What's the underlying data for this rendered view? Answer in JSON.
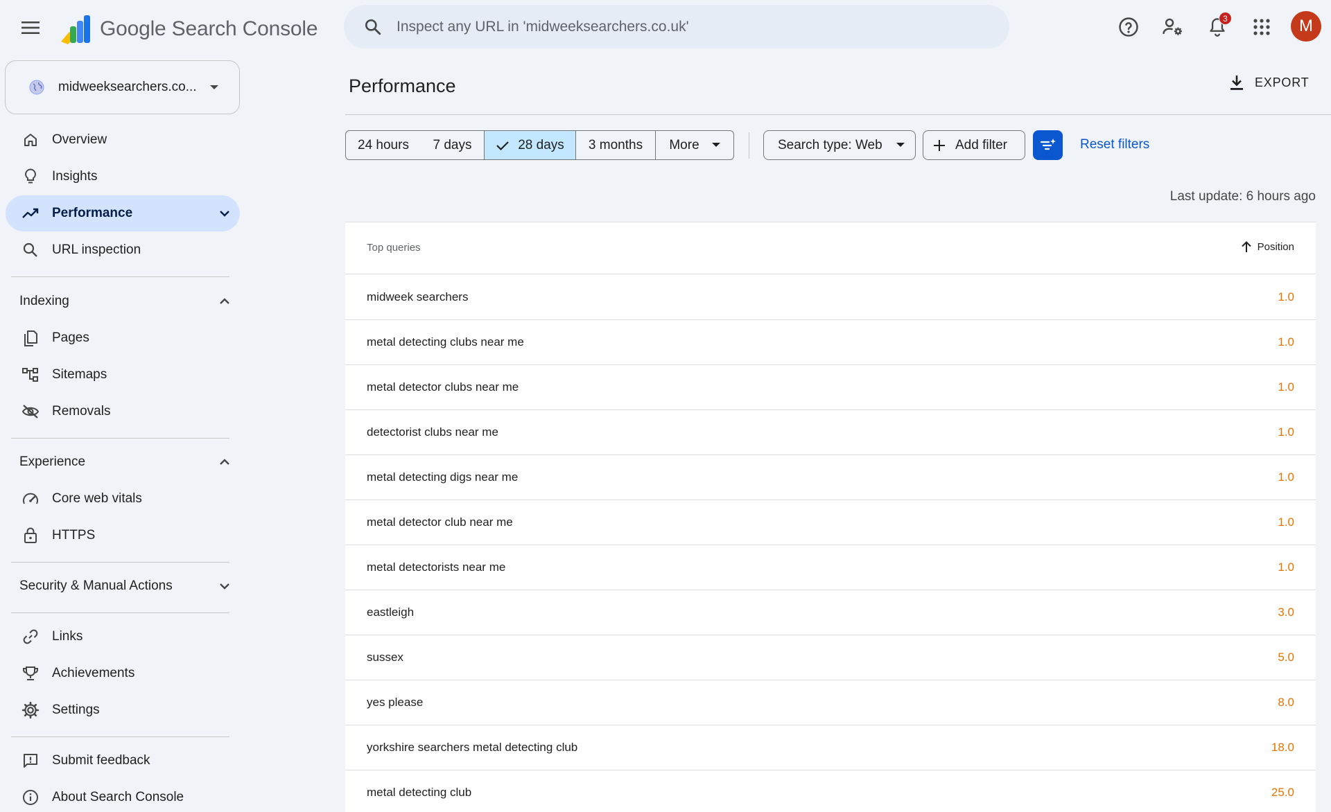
{
  "app": {
    "title": "Google Search Console",
    "search_placeholder": "Inspect any URL in 'midweeksearchers.co.uk'",
    "notification_count": "3",
    "avatar_letter": "M"
  },
  "sidebar": {
    "property": "midweeksearchers.co...",
    "items_top": [
      {
        "label": "Overview",
        "icon": "home-icon"
      },
      {
        "label": "Insights",
        "icon": "lightbulb-icon"
      },
      {
        "label": "Performance",
        "icon": "trending-up-icon"
      },
      {
        "label": "URL inspection",
        "icon": "search-icon"
      }
    ],
    "indexing": {
      "label": "Indexing",
      "items": [
        {
          "label": "Pages",
          "icon": "pages-icon"
        },
        {
          "label": "Sitemaps",
          "icon": "sitemap-icon"
        },
        {
          "label": "Removals",
          "icon": "visibility-off-icon"
        }
      ]
    },
    "experience": {
      "label": "Experience",
      "items": [
        {
          "label": "Core web vitals",
          "icon": "speed-gauge-icon"
        },
        {
          "label": "HTTPS",
          "icon": "lock-icon"
        }
      ]
    },
    "security": {
      "label": "Security & Manual Actions"
    },
    "items_bottom": [
      {
        "label": "Links",
        "icon": "link-icon"
      },
      {
        "label": "Achievements",
        "icon": "trophy-icon"
      },
      {
        "label": "Settings",
        "icon": "gear-icon"
      }
    ],
    "items_footer": [
      {
        "label": "Submit feedback",
        "icon": "feedback-icon"
      },
      {
        "label": "About Search Console",
        "icon": "info-icon"
      }
    ]
  },
  "main": {
    "title": "Performance",
    "export_label": "EXPORT",
    "date_ranges": [
      "24 hours",
      "7 days",
      "28 days",
      "3 months",
      "More"
    ],
    "selected_range": "28 days",
    "search_type": "Search type: Web",
    "add_filter": "Add filter",
    "reset_filters": "Reset filters",
    "last_update": "Last update: 6 hours ago"
  },
  "table": {
    "header_query": "Top queries",
    "header_position": "Position",
    "rows": [
      {
        "query": "midweek searchers",
        "position": "1.0"
      },
      {
        "query": "metal detecting clubs near me",
        "position": "1.0"
      },
      {
        "query": "metal detector clubs near me",
        "position": "1.0"
      },
      {
        "query": "detectorist clubs near me",
        "position": "1.0"
      },
      {
        "query": "metal detecting digs near me",
        "position": "1.0"
      },
      {
        "query": "metal detector club near me",
        "position": "1.0"
      },
      {
        "query": "metal detectorists near me",
        "position": "1.0"
      },
      {
        "query": "eastleigh",
        "position": "3.0"
      },
      {
        "query": "sussex",
        "position": "5.0"
      },
      {
        "query": "yes please",
        "position": "8.0"
      },
      {
        "query": "yorkshire searchers metal detecting club",
        "position": "18.0"
      },
      {
        "query": "metal detecting club",
        "position": "25.0"
      }
    ]
  },
  "colors": {
    "accent": "#0b57d0",
    "selected_bg": "#c2e7ff",
    "nav_active_bg": "#d3e3fd",
    "position_text": "#e37400",
    "avatar": "#c53a1b"
  }
}
